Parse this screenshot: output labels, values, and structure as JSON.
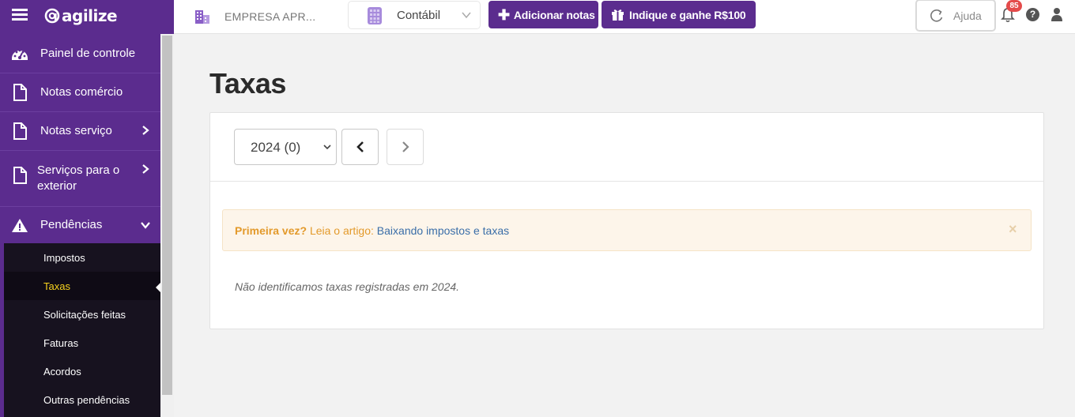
{
  "header": {
    "brand": "agilize",
    "company_name": "EMPRESA APR...",
    "module_selected": "Contábil",
    "add_notes_label": "Adicionar notas",
    "referral_label": "Indique e ganhe R$100",
    "help_label": "Ajuda",
    "notification_count": "85",
    "help_icon_glyph": "?"
  },
  "sidebar": {
    "items": [
      {
        "label": "Painel de controle",
        "icon": "dashboard-icon"
      },
      {
        "label": "Notas comércio",
        "icon": "file-icon"
      },
      {
        "label": "Notas serviço",
        "icon": "file-icon",
        "expandable": true
      },
      {
        "label": "Serviços para o exterior",
        "icon": "file-icon",
        "expandable": true
      },
      {
        "label": "Pendências",
        "icon": "warning-icon",
        "expanded": true
      }
    ],
    "submenu": [
      {
        "label": "Impostos"
      },
      {
        "label": "Taxas",
        "active": true
      },
      {
        "label": "Solicitações feitas"
      },
      {
        "label": "Faturas"
      },
      {
        "label": "Acordos"
      },
      {
        "label": "Outras pendências"
      }
    ]
  },
  "main": {
    "title": "Taxas",
    "year_select": "2024 (0)",
    "alert": {
      "strong": "Primeira vez?",
      "text": "Leia o artigo:",
      "link": "Baixando impostos e taxas",
      "close": "×"
    },
    "empty_message": "Não identificamos taxas registradas em 2024."
  },
  "colors": {
    "brand_purple": "#5b2c8e",
    "active_submenu": "#f5d11e",
    "alert_bg": "#fdf5ea",
    "alert_text": "#e39a2b",
    "link": "#3a6ea8",
    "badge": "#e44b4b"
  }
}
